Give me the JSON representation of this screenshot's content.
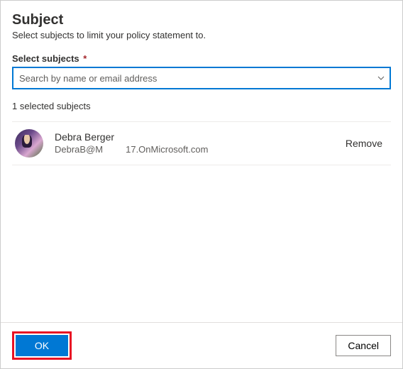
{
  "header": {
    "title": "Subject",
    "subtitle": "Select subjects to limit your policy statement to."
  },
  "field": {
    "label": "Select subjects",
    "required_mark": "*",
    "placeholder": "Search by name or email address"
  },
  "selected_summary": "1 selected subjects",
  "subjects": [
    {
      "name": "Debra Berger",
      "email_part1": "DebraB@M",
      "email_part2": "17.OnMicrosoft.com",
      "remove_label": "Remove"
    }
  ],
  "footer": {
    "ok_label": "OK",
    "cancel_label": "Cancel"
  }
}
